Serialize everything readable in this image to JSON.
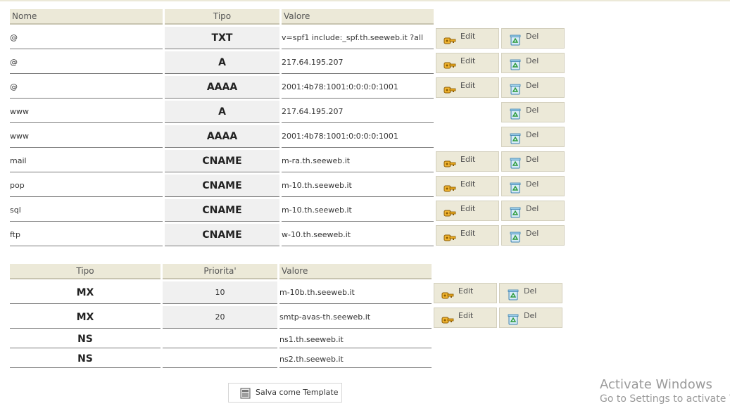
{
  "records_table": {
    "headers": {
      "name": "Nome",
      "type": "Tipo",
      "value": "Valore"
    },
    "rows": [
      {
        "name": "@",
        "type": "TXT",
        "value": "v=spf1 include:_spf.th.seeweb.it ?all"
      },
      {
        "name": "@",
        "type": "A",
        "value": "217.64.195.207"
      },
      {
        "name": "@",
        "type": "AAAA",
        "value": "2001:4b78:1001:0:0:0:0:1001"
      },
      {
        "name": "www",
        "type": "A",
        "value": "217.64.195.207"
      },
      {
        "name": "www",
        "type": "AAAA",
        "value": "2001:4b78:1001:0:0:0:0:1001"
      },
      {
        "name": "mail",
        "type": "CNAME",
        "value": "m-ra.th.seeweb.it"
      },
      {
        "name": "pop",
        "type": "CNAME",
        "value": "m-10.th.seeweb.it"
      },
      {
        "name": "sql",
        "type": "CNAME",
        "value": "m-10.th.seeweb.it"
      },
      {
        "name": "ftp",
        "type": "CNAME",
        "value": "w-10.th.seeweb.it"
      }
    ]
  },
  "mx_table": {
    "headers": {
      "type": "Tipo",
      "priority": "Priorita'",
      "value": "Valore"
    },
    "rows": [
      {
        "type": "MX",
        "priority": "10",
        "value": "m-10b.th.seeweb.it"
      },
      {
        "type": "MX",
        "priority": "20",
        "value": "smtp-avas-th.seeweb.it"
      },
      {
        "type": "NS",
        "priority": "",
        "value": "ns1.th.seeweb.it"
      },
      {
        "type": "NS",
        "priority": "",
        "value": "ns2.th.seeweb.it"
      }
    ]
  },
  "actions": {
    "edit_label": "Edit",
    "delete_label": "Del"
  },
  "save_template_label": "Salva come Template",
  "watermark": {
    "line1": "Activate Windows",
    "line2": "Go to Settings to activate W"
  },
  "colors": {
    "header_bg": "#ece9d8",
    "button_bg": "#ece9d8",
    "type_cell_bg": "#f0f0f0"
  },
  "icons": {
    "edit": "key-icon",
    "delete": "recycle-icon",
    "save": "document-icon"
  }
}
